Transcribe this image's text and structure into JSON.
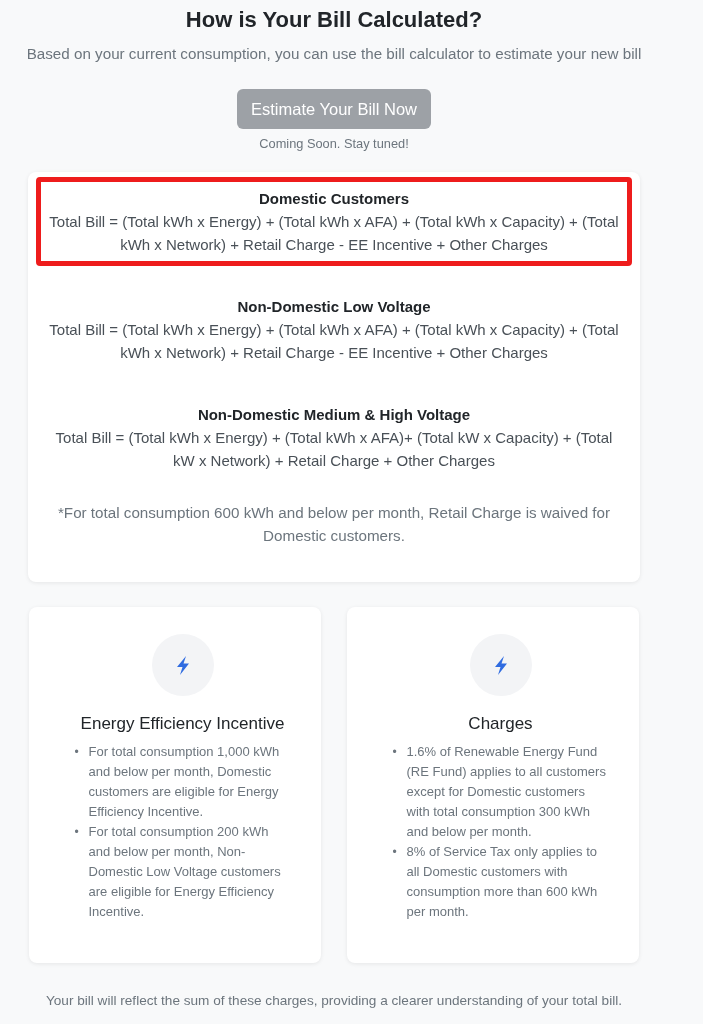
{
  "heading": {
    "title": "How is Your Bill Calculated?",
    "subtitle": "Based on your current consumption, you can use the bill calculator to estimate your new bill"
  },
  "estimate": {
    "button": {
      "label": "Estimate Your Bill Now",
      "disabled": true
    },
    "note": "Coming Soon. Stay tuned!"
  },
  "formulas": {
    "items": [
      {
        "title": "Domestic Customers",
        "formula": "Total Bill = (Total kWh x Energy) + (Total kWh x AFA) + (Total kWh x Capacity) + (Total kWh x Network) + Retail Charge - EE Incentive + Other Charges",
        "highlighted": true
      },
      {
        "title": "Non-Domestic Low Voltage",
        "formula": "Total Bill = (Total kWh x Energy) + (Total kWh x AFA) + (Total kWh x Capacity) + (Total kWh x Network) + Retail Charge - EE Incentive + Other Charges",
        "highlighted": false
      },
      {
        "title": "Non-Domestic Medium & High Voltage",
        "formula": "Total Bill = (Total kWh x Energy) + (Total kWh x AFA)+ (Total kW x Capacity) + (Total kW x Network) + Retail Charge + Other Charges",
        "highlighted": false
      }
    ],
    "footnote": "*For total consumption 600 kWh and below per month, Retail Charge is waived for Domestic customers."
  },
  "info_cards": [
    {
      "title": "Energy Efficiency Incentive",
      "points": [
        {
          "marker": "•",
          "text": "For total consumption 1,000 kWh and below per month, Domestic customers are eligible for Energy Efficiency Incentive."
        },
        {
          "marker": "•",
          "text": "For total consumption 200 kWh and below per month, Non-Domestic Low Voltage customers are eligible for Energy Efficiency Incentive."
        }
      ]
    },
    {
      "title": "Charges",
      "points": [
        {
          "marker": "•",
          "text": "1.6% of Renewable Energy Fund (RE Fund) applies to all customers except for Domestic customers with total consumption 300 kWh and below per month."
        },
        {
          "marker": "•",
          "text": "8% of Service Tax only applies to all Domestic customers with consumption more than 600 kWh per month."
        }
      ]
    }
  ],
  "footer": "Your bill will reflect the sum of these charges, providing a clearer understanding of your total bill."
}
